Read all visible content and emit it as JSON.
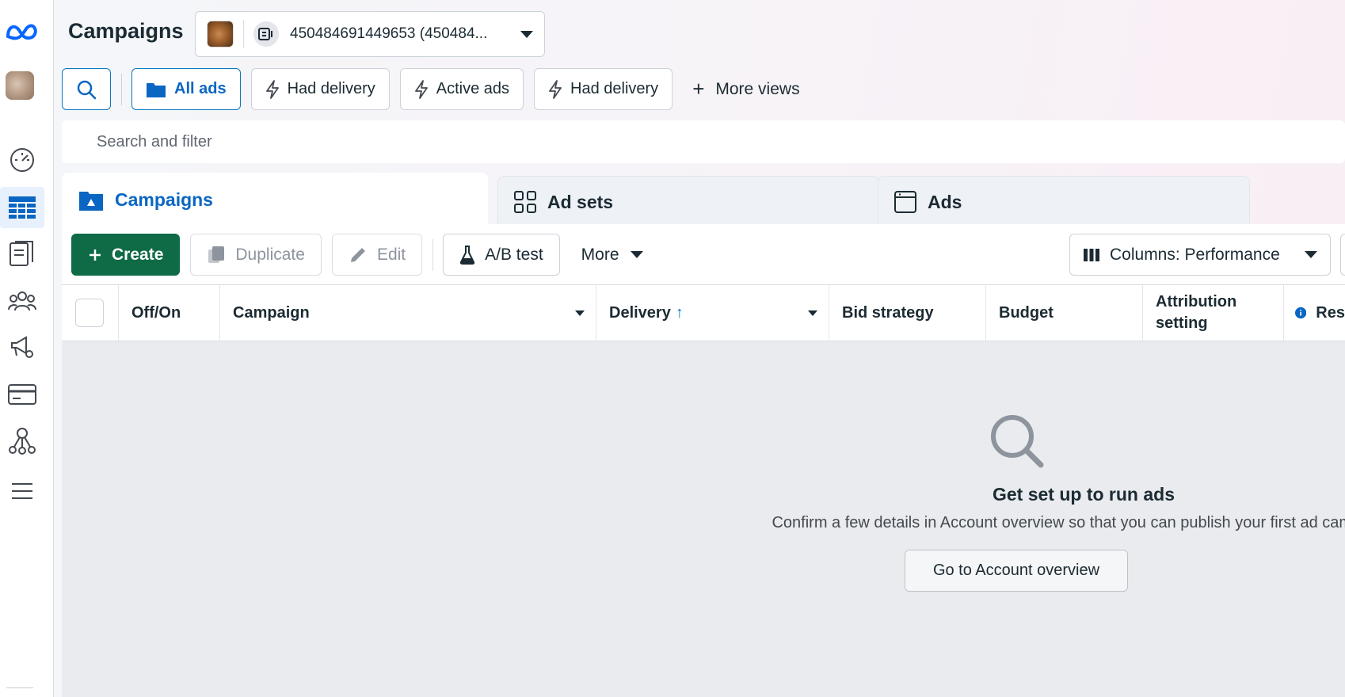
{
  "header": {
    "title": "Campaigns",
    "account_label": "450484691449653 (450484..."
  },
  "views": {
    "items": [
      {
        "label": "All ads",
        "active": true
      },
      {
        "label": "Had delivery"
      },
      {
        "label": "Active ads"
      },
      {
        "label": "Had delivery"
      }
    ],
    "more_label": "More views"
  },
  "search": {
    "placeholder": "Search and filter"
  },
  "tabs": [
    {
      "label": "Campaigns"
    },
    {
      "label": "Ad sets"
    },
    {
      "label": "Ads"
    }
  ],
  "toolbar": {
    "create_label": "Create",
    "duplicate_label": "Duplicate",
    "edit_label": "Edit",
    "ab_test_label": "A/B test",
    "more_label": "More",
    "columns_label": "Columns: Performance"
  },
  "table": {
    "columns": [
      "Off/On",
      "Campaign",
      "Delivery",
      "Bid strategy",
      "Budget",
      "Attribution setting",
      "Res"
    ]
  },
  "empty_state": {
    "title": "Get set up to run ads",
    "description": "Confirm a few details in Account overview so that you can publish your first ad campaign.",
    "button_label": "Go to Account overview"
  },
  "colors": {
    "primary_green": "#0e6b46",
    "accent_blue": "#0a66c2",
    "empty_bg": "#e9ebee"
  }
}
